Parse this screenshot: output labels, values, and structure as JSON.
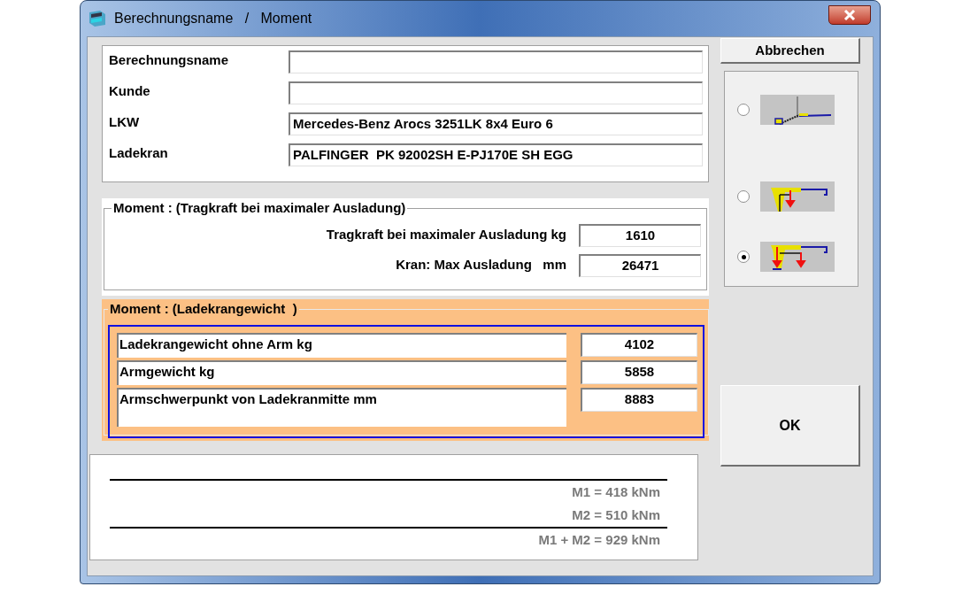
{
  "window": {
    "title": "Berechnungsname   /   Moment"
  },
  "general": {
    "fields": [
      {
        "label": "Berechnungsname"
      },
      {
        "label": "Kunde"
      },
      {
        "label": "LKW",
        "value": "Mercedes-Benz Arocs 3251LK 8x4 Euro 6"
      },
      {
        "label": "Ladekran",
        "value": "PALFINGER  PK 92002SH E-PJ170E SH EGG"
      }
    ]
  },
  "section_capacity": {
    "title": "Moment : (Tragkraft bei maximaler Ausladung)",
    "rows": [
      {
        "label": "Tragkraft bei maximaler Ausladung kg",
        "value": "1610"
      },
      {
        "label": "Kran: Max Ausladung   mm",
        "value": "26471"
      }
    ]
  },
  "section_weight": {
    "title": "Moment : (Ladekrangewicht  )",
    "rows": [
      {
        "label": "Ladekrangewicht ohne Arm kg",
        "value": "4102"
      },
      {
        "label": "Armgewicht kg",
        "value": "5858"
      },
      {
        "label": "Armschwerpunkt von Ladekranmitte mm",
        "value": "8883"
      }
    ]
  },
  "results": [
    "M1 = 418 kNm",
    "M2 = 510 kNm",
    "M1 + M2 = 929 kNm"
  ],
  "buttons": {
    "cancel": "Abbrechen",
    "ok": "OK"
  },
  "crane_options": [
    {
      "selected": false
    },
    {
      "selected": false
    },
    {
      "selected": true
    }
  ]
}
